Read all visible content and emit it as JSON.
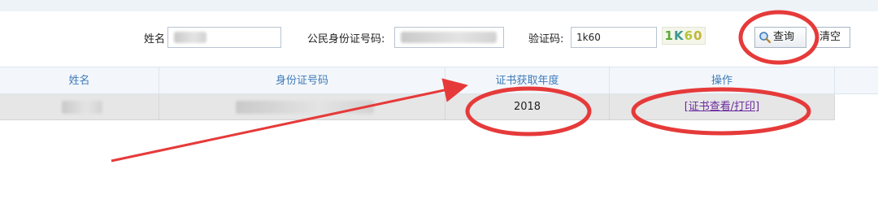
{
  "search": {
    "name_label": "姓名",
    "name_value": "",
    "id_label": "公民身份证号码:",
    "id_value": "",
    "captcha_label": "验证码:",
    "captcha_value": "1k60",
    "captcha_image": [
      "1",
      "K",
      "6",
      "0"
    ],
    "query_button": "查询",
    "clear_button": "清空"
  },
  "table": {
    "columns": [
      "姓名",
      "身份证号码",
      "证书获取年度",
      "操作"
    ],
    "rows": [
      {
        "name": "",
        "id_number": "",
        "year": "2018",
        "action": "[证书查看/打印]"
      }
    ]
  },
  "colors": {
    "header_text": "#3f7ab8",
    "link": "#6a2a9e",
    "annotation_red": "#e63a3a",
    "row_bg": "#e6e6e6"
  }
}
